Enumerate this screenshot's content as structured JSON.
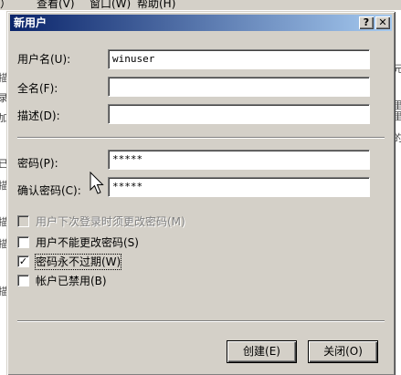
{
  "bg_menu": [
    "）",
    "查看(V)",
    "窗口(W)",
    "帮助(H)"
  ],
  "bg_left_glyphs": [
    "描",
    "录",
    "加",
    "已",
    "描",
    "描",
    "描",
    "描"
  ],
  "bg_right_glyphs": [
    "元",
    "里",
    "里",
    "的"
  ],
  "dialog": {
    "title": "新用户",
    "help_button": "?",
    "close_button": "✕"
  },
  "form": {
    "username_label": "用户名(U):",
    "username_value": "winuser",
    "fullname_label": "全名(F):",
    "fullname_value": "",
    "description_label": "描述(D):",
    "description_value": "",
    "password_label": "密码(P):",
    "password_value": "*****",
    "confirm_label": "确认密码(C):",
    "confirm_value": "*****"
  },
  "options": [
    {
      "label": "用户下次登录时须更改密码(M)",
      "checked": false,
      "disabled": true
    },
    {
      "label": "用户不能更改密码(S)",
      "checked": false,
      "disabled": false
    },
    {
      "label": "密码永不过期(W)",
      "checked": true,
      "disabled": false
    },
    {
      "label": "帐户已禁用(B)",
      "checked": false,
      "disabled": false
    }
  ],
  "check_mark": "✓",
  "buttons": {
    "create": "创建(E)",
    "close": "关闭(O)"
  },
  "colors": {
    "title_gradient_start": "#0a246a",
    "title_gradient_end": "#a6caf0",
    "dialog_face": "#d4d0c8"
  }
}
